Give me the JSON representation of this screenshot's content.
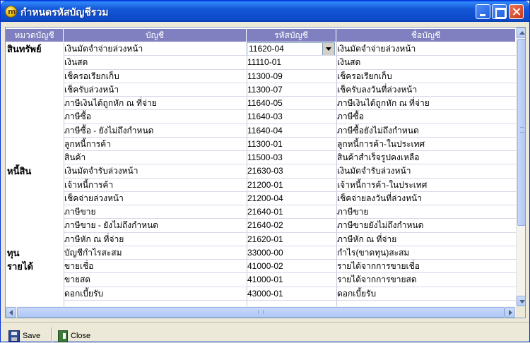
{
  "window": {
    "title": "กำหนดรหัสบัญชีรวม",
    "app_icon_letter": "m"
  },
  "grid": {
    "columns": [
      "หมวดบัญชี",
      "บัญชี",
      "รหัสบัญชี",
      "ชื่อบัญชี"
    ],
    "rows": [
      {
        "category": "สินทรัพย์",
        "name": "เงินมัดจำจ่ายล่วงหน้า",
        "code": "11620-04",
        "account": "เงินมัดจำจ่ายล่วงหน้า"
      },
      {
        "category": "",
        "name": "เงินสด",
        "code": "11110-01",
        "account": "เงินสด"
      },
      {
        "category": "",
        "name": "เช็ครอเรียกเก็บ",
        "code": "11300-09",
        "account": "เช็ครอเรียกเก็บ"
      },
      {
        "category": "",
        "name": "เช็ครับล่วงหน้า",
        "code": "11300-07",
        "account": "เช็ครับลงวันที่ล่วงหน้า"
      },
      {
        "category": "",
        "name": "ภาษีเงินได้ถูกหัก ณ ที่จ่าย",
        "code": "11640-05",
        "account": "ภาษีเงินได้ถูกหัก ณ ที่จ่าย"
      },
      {
        "category": "",
        "name": "ภาษีซื้อ",
        "code": "11640-03",
        "account": "ภาษีซื้อ"
      },
      {
        "category": "",
        "name": "ภาษีซื้อ - ยังไม่ถึงกำหนด",
        "code": "11640-04",
        "account": "ภาษีซื้อยังไม่ถึงกำหนด"
      },
      {
        "category": "",
        "name": "ลูกหนี้การค้า",
        "code": "11300-01",
        "account": "ลูกหนี้การค้า-ในประเทศ"
      },
      {
        "category": "",
        "name": "สินค้า",
        "code": "11500-03",
        "account": "สินค้าสำเร็จรูปคงเหลือ"
      },
      {
        "category": "หนี้สิน",
        "name": "เงินมัดจำรับล่วงหน้า",
        "code": "21630-03",
        "account": "เงินมัดจำรับล่วงหน้า"
      },
      {
        "category": "",
        "name": "เจ้าหนี้การค้า",
        "code": "21200-01",
        "account": "เจ้าหนี้การค้า-ในประเทศ"
      },
      {
        "category": "",
        "name": "เช็คจ่ายล่วงหน้า",
        "code": "21200-04",
        "account": "เช็คจ่ายลงวันที่ล่วงหน้า"
      },
      {
        "category": "",
        "name": "ภาษีขาย",
        "code": "21640-01",
        "account": "ภาษีขาย"
      },
      {
        "category": "",
        "name": "ภาษีขาย - ยังไม่ถึงกำหนด",
        "code": "21640-02",
        "account": "ภาษีขายยังไม่ถึงกำหนด"
      },
      {
        "category": "",
        "name": "ภาษีหัก ณ ที่จ่าย",
        "code": "21620-01",
        "account": "ภาษีหัก ณ ที่จ่าย"
      },
      {
        "category": "ทุน",
        "name": "บัญชีกำไรสะสม",
        "code": "33000-00",
        "account": "กำไร(ขาดทุน)สะสม"
      },
      {
        "category": "รายได้",
        "name": "ขายเชื่อ",
        "code": "41000-02",
        "account": "รายได้จากการขายเชื่อ"
      },
      {
        "category": "",
        "name": "ขายสด",
        "code": "41000-01",
        "account": "รายได้จากการขายสด"
      },
      {
        "category": "",
        "name": "ดอกเบี้ยรับ",
        "code": "43000-01",
        "account": "ดอกเบี้ยรับ"
      }
    ]
  },
  "toolbar": {
    "save_label": "Save",
    "close_label": "Close"
  }
}
